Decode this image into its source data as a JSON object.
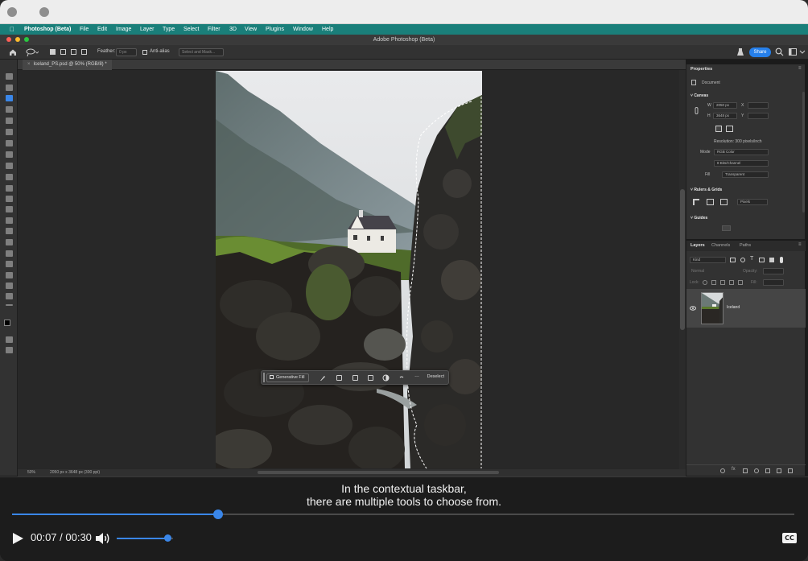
{
  "menubar": {
    "app": "Photoshop (Beta)",
    "items": [
      "File",
      "Edit",
      "Image",
      "Layer",
      "Type",
      "Select",
      "Filter",
      "3D",
      "View",
      "Plugins",
      "Window",
      "Help"
    ]
  },
  "window_title": "Adobe Photoshop (Beta)",
  "options": {
    "feather_label": "Feather:",
    "feather_value": "0 px",
    "antialias_label": "Anti-alias",
    "select_mask": "Select and Mask...",
    "share_label": "Share"
  },
  "document_tab": "Iceland_PS.psd @ 50% (RGB/8) *",
  "status": {
    "zoom": "50%",
    "dimensions": "2050 px x 3648 px (300 ppi)"
  },
  "contextual_bar": {
    "generative_fill": "Generative Fill",
    "deselect": "Deselect",
    "more": "…"
  },
  "properties": {
    "tab": "Properties",
    "document_label": "Document",
    "canvas_section": "Canvas",
    "w_label": "W",
    "w_value": "2050 px",
    "h_label": "H",
    "h_value": "3648 px",
    "x_label": "X",
    "y_label": "Y",
    "resolution": "Resolution: 300 pixels/inch",
    "mode_label": "Mode",
    "mode_value": "RGB Color",
    "bit_depth": "8 Bits/Channel",
    "fill_label": "Fill",
    "fill_value": "Transparent",
    "rulers_section": "Rulers & Grids",
    "units_value": "Pixels",
    "guides_section": "Guides"
  },
  "layers": {
    "tabs": [
      "Layers",
      "Channels",
      "Paths"
    ],
    "kind_label": "Kind",
    "blend_mode": "Normal",
    "opacity_label": "Opacity:",
    "lock_label": "Lock:",
    "fill_label": "Fill:",
    "layer_name": "Iceland"
  },
  "video": {
    "caption_line1": "In the contextual taskbar,",
    "caption_line2": "there are multiple tools to choose from.",
    "current_time": "00:07",
    "duration": "00:30",
    "time_display": "00:07 / 00:30",
    "progress": 0.2633,
    "volume": 0.9,
    "cc_label": "CC"
  },
  "colors": {
    "accent": "#3a86e8",
    "menubar": "#1a7f7a",
    "share": "#2680eb"
  }
}
